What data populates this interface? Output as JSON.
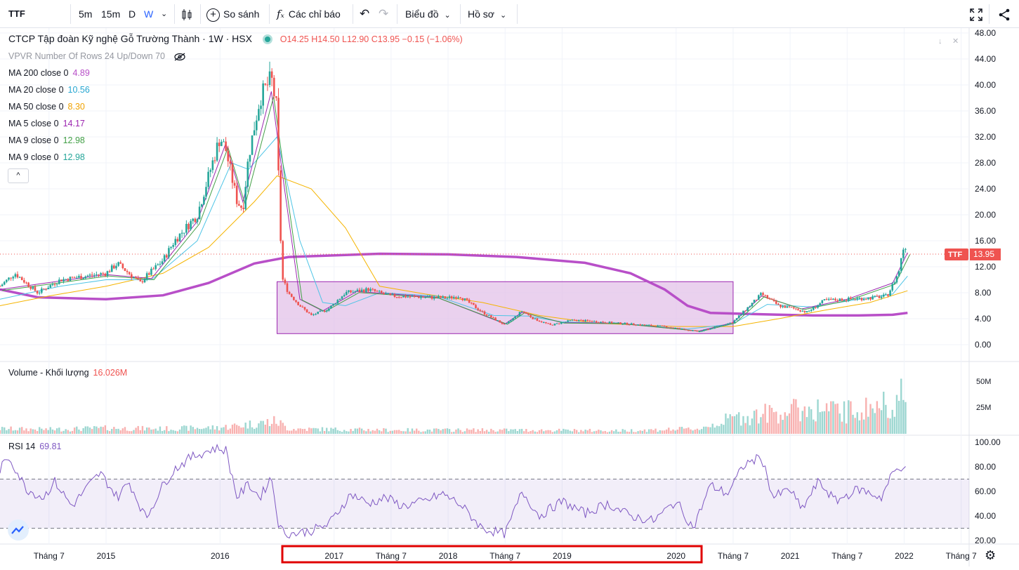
{
  "toolbar": {
    "symbol": "TTF",
    "intervals": [
      "5m",
      "15m",
      "D",
      "W"
    ],
    "active_interval": "W",
    "compare_label": "So sánh",
    "indicators_label": "Các chỉ báo",
    "chart_type_label": "Biểu đồ",
    "profile_label": "Hồ sơ"
  },
  "legend": {
    "title": "CTCP Tập đoàn Kỹ nghệ Gỗ Trường Thành · 1W · HSX",
    "ohlc": {
      "o": "O14.25",
      "h": "H14.50",
      "l": "L12.90",
      "c": "C13.95",
      "chg": "−0.15 (−1.06%)"
    },
    "vpvr": "VPVR Number Of Rows 24 Up/Down 70",
    "ma": [
      {
        "label": "MA 200 close 0",
        "value": "4.89",
        "color": "#b84fc8"
      },
      {
        "label": "MA 20 close 0",
        "value": "10.56",
        "color": "#26a6d1"
      },
      {
        "label": "MA 50 close 0",
        "value": "8.30",
        "color": "#f0a200"
      },
      {
        "label": "MA 5 close 0",
        "value": "14.17",
        "color": "#9c27b0"
      },
      {
        "label": "MA 9 close 0",
        "value": "12.98",
        "color": "#43a047"
      },
      {
        "label": "MA 9 close 0",
        "value": "12.98",
        "color": "#26a69a"
      }
    ],
    "collapse": "^"
  },
  "volume_legend": {
    "label": "Volume - Khối lượng",
    "value": "16.026M"
  },
  "rsi_legend": {
    "label": "RSI 14",
    "value": "69.81"
  },
  "price_label": {
    "symbol": "TTF",
    "value": "13.95"
  },
  "colors": {
    "up": "#26a69a",
    "down": "#ef5350",
    "ma200": "#b84fc8",
    "rsi": "#7e57c2",
    "box": "#e1bee7"
  },
  "chart_data": {
    "type": "candlestick",
    "price_axis": {
      "ticks": [
        "48.00",
        "44.00",
        "40.00",
        "36.00",
        "32.00",
        "28.00",
        "24.00",
        "20.00",
        "16.00",
        "12.00",
        "8.00",
        "4.00",
        "0.00"
      ],
      "ylim": [
        0,
        48
      ]
    },
    "volume_axis": {
      "ticks": [
        "50M",
        "25M"
      ]
    },
    "rsi_axis": {
      "ticks": [
        "100.00",
        "80.00",
        "60.00",
        "40.00",
        "20.00"
      ],
      "bands": [
        70,
        30
      ]
    },
    "time_axis": [
      "Tháng 7",
      "2015",
      "2016",
      "2017",
      "Tháng 7",
      "2018",
      "Tháng 7",
      "2019",
      "2020",
      "Tháng 7",
      "2021",
      "Tháng 7",
      "2022",
      "Tháng 7"
    ],
    "time_axis_x": [
      2014.5,
      2015.0,
      2016.0,
      2017.0,
      2017.5,
      2018.0,
      2018.5,
      2019.0,
      2020.0,
      2020.5,
      2021.0,
      2021.5,
      2022.0,
      2022.5
    ],
    "xlim": [
      2014.07,
      2022.57
    ],
    "price_close_points": [
      [
        2014.07,
        9.0
      ],
      [
        2014.2,
        11.0
      ],
      [
        2014.3,
        9.5
      ],
      [
        2014.4,
        8.0
      ],
      [
        2014.6,
        10.0
      ],
      [
        2014.8,
        10.5
      ],
      [
        2015.0,
        11.0
      ],
      [
        2015.1,
        12.5
      ],
      [
        2015.2,
        11.0
      ],
      [
        2015.3,
        9.5
      ],
      [
        2015.35,
        10.5
      ],
      [
        2015.5,
        13.0
      ],
      [
        2015.6,
        16.0
      ],
      [
        2015.7,
        18.0
      ],
      [
        2015.8,
        20.0
      ],
      [
        2015.9,
        26.0
      ],
      [
        2016.0,
        32.0
      ],
      [
        2016.05,
        30.0
      ],
      [
        2016.15,
        22.0
      ],
      [
        2016.2,
        21.0
      ],
      [
        2016.25,
        29.0
      ],
      [
        2016.35,
        38.0
      ],
      [
        2016.45,
        41.0
      ],
      [
        2016.5,
        36.0
      ],
      [
        2016.52,
        20.0
      ],
      [
        2016.55,
        10.0
      ],
      [
        2016.6,
        8.0
      ],
      [
        2016.7,
        6.0
      ],
      [
        2016.8,
        4.5
      ],
      [
        2016.95,
        5.5
      ],
      [
        2017.1,
        8.0
      ],
      [
        2017.3,
        8.5
      ],
      [
        2017.5,
        7.5
      ],
      [
        2018.0,
        7.2
      ],
      [
        2018.1,
        7.5
      ],
      [
        2018.3,
        5.0
      ],
      [
        2018.5,
        3.0
      ],
      [
        2018.65,
        5.2
      ],
      [
        2018.75,
        4.0
      ],
      [
        2018.9,
        3.0
      ],
      [
        2019.1,
        3.8
      ],
      [
        2019.5,
        3.3
      ],
      [
        2019.9,
        2.8
      ],
      [
        2020.2,
        2.0
      ],
      [
        2020.4,
        3.0
      ],
      [
        2020.5,
        3.5
      ],
      [
        2020.75,
        7.8
      ],
      [
        2020.9,
        6.0
      ],
      [
        2021.05,
        5.5
      ],
      [
        2021.15,
        5.0
      ],
      [
        2021.3,
        6.8
      ],
      [
        2021.5,
        7.0
      ],
      [
        2021.7,
        7.2
      ],
      [
        2021.85,
        7.5
      ],
      [
        2021.95,
        11.0
      ],
      [
        2022.0,
        15.5
      ],
      [
        2022.03,
        13.95
      ]
    ],
    "ma200_points": [
      [
        2014.07,
        8.5
      ],
      [
        2014.4,
        7.3
      ],
      [
        2015.0,
        7.0
      ],
      [
        2015.5,
        7.6
      ],
      [
        2015.9,
        9.5
      ],
      [
        2016.3,
        12.5
      ],
      [
        2016.6,
        13.5
      ],
      [
        2017.4,
        14.0
      ],
      [
        2018.0,
        13.9
      ],
      [
        2018.6,
        13.5
      ],
      [
        2019.2,
        12.6
      ],
      [
        2019.6,
        11.0
      ],
      [
        2019.9,
        8.5
      ],
      [
        2020.1,
        6.0
      ],
      [
        2020.3,
        4.9
      ],
      [
        2020.7,
        4.7
      ],
      [
        2021.2,
        4.5
      ],
      [
        2021.6,
        4.5
      ],
      [
        2021.9,
        4.6
      ],
      [
        2022.03,
        4.9
      ]
    ],
    "ma50_points": [
      [
        2014.07,
        6.0
      ],
      [
        2014.5,
        7.5
      ],
      [
        2015.0,
        9.0
      ],
      [
        2015.5,
        11.0
      ],
      [
        2015.9,
        15.0
      ],
      [
        2016.3,
        22.0
      ],
      [
        2016.5,
        26.0
      ],
      [
        2016.8,
        24.0
      ],
      [
        2017.1,
        18.0
      ],
      [
        2017.4,
        9.0
      ],
      [
        2017.8,
        7.8
      ],
      [
        2018.3,
        6.5
      ],
      [
        2018.8,
        4.5
      ],
      [
        2019.3,
        3.3
      ],
      [
        2020.0,
        2.8
      ],
      [
        2020.5,
        2.8
      ],
      [
        2020.9,
        4.0
      ],
      [
        2021.3,
        5.3
      ],
      [
        2021.7,
        6.5
      ],
      [
        2022.03,
        8.3
      ]
    ],
    "ma20_points": [
      [
        2014.07,
        7.0
      ],
      [
        2014.6,
        9.0
      ],
      [
        2015.0,
        10.0
      ],
      [
        2015.4,
        10.0
      ],
      [
        2015.8,
        16.0
      ],
      [
        2016.1,
        28.0
      ],
      [
        2016.25,
        27.0
      ],
      [
        2016.5,
        32.0
      ],
      [
        2016.7,
        16.0
      ],
      [
        2016.9,
        6.5
      ],
      [
        2017.1,
        6.0
      ],
      [
        2017.4,
        8.0
      ],
      [
        2017.9,
        7.5
      ],
      [
        2018.4,
        4.5
      ],
      [
        2018.7,
        4.4
      ],
      [
        2019.0,
        3.5
      ],
      [
        2019.5,
        3.3
      ],
      [
        2020.1,
        2.4
      ],
      [
        2020.5,
        3.2
      ],
      [
        2020.8,
        6.2
      ],
      [
        2021.2,
        5.8
      ],
      [
        2021.6,
        7.0
      ],
      [
        2021.9,
        7.8
      ],
      [
        2022.03,
        10.56
      ]
    ],
    "ma5_points": [
      [
        2014.07,
        8.5
      ],
      [
        2014.6,
        9.8
      ],
      [
        2015.0,
        10.8
      ],
      [
        2015.4,
        10.2
      ],
      [
        2015.8,
        19.0
      ],
      [
        2016.05,
        31.0
      ],
      [
        2016.2,
        22.0
      ],
      [
        2016.45,
        39.0
      ],
      [
        2016.55,
        26.0
      ],
      [
        2016.7,
        7.0
      ],
      [
        2016.9,
        5.2
      ],
      [
        2017.2,
        8.2
      ],
      [
        2017.9,
        7.3
      ],
      [
        2018.5,
        3.2
      ],
      [
        2018.65,
        5.0
      ],
      [
        2019.0,
        3.4
      ],
      [
        2019.5,
        3.3
      ],
      [
        2020.2,
        2.1
      ],
      [
        2020.5,
        3.4
      ],
      [
        2020.75,
        7.5
      ],
      [
        2021.1,
        5.5
      ],
      [
        2021.5,
        7.0
      ],
      [
        2021.9,
        9.5
      ],
      [
        2022.03,
        14.17
      ]
    ],
    "box": {
      "x0": 2016.5,
      "x1": 2020.5,
      "y0": 1.7,
      "y1": 9.7
    },
    "last_price": 13.95,
    "volume_points": [
      [
        2014.07,
        8
      ],
      [
        2014.5,
        7
      ],
      [
        2015.0,
        9
      ],
      [
        2015.5,
        8
      ],
      [
        2016.0,
        10
      ],
      [
        2016.5,
        20
      ],
      [
        2016.6,
        8
      ],
      [
        2017.5,
        6
      ],
      [
        2018.5,
        6
      ],
      [
        2019.5,
        5
      ],
      [
        2020.2,
        8
      ],
      [
        2020.5,
        25
      ],
      [
        2020.9,
        35
      ],
      [
        2021.2,
        40
      ],
      [
        2021.5,
        35
      ],
      [
        2021.8,
        45
      ],
      [
        2022.0,
        60
      ],
      [
        2022.03,
        16
      ]
    ],
    "rsi_points": [
      [
        2014.07,
        78
      ],
      [
        2014.15,
        88
      ],
      [
        2014.3,
        62
      ],
      [
        2014.45,
        55
      ],
      [
        2014.55,
        68
      ],
      [
        2014.7,
        48
      ],
      [
        2014.85,
        65
      ],
      [
        2014.95,
        75
      ],
      [
        2015.1,
        55
      ],
      [
        2015.2,
        68
      ],
      [
        2015.35,
        38
      ],
      [
        2015.5,
        65
      ],
      [
        2015.6,
        78
      ],
      [
        2015.75,
        88
      ],
      [
        2015.95,
        95
      ],
      [
        2016.05,
        94
      ],
      [
        2016.15,
        55
      ],
      [
        2016.25,
        66
      ],
      [
        2016.35,
        55
      ],
      [
        2016.45,
        72
      ],
      [
        2016.52,
        30
      ],
      [
        2016.6,
        25
      ],
      [
        2016.8,
        28
      ],
      [
        2016.95,
        33
      ],
      [
        2017.15,
        58
      ],
      [
        2017.3,
        50
      ],
      [
        2017.45,
        55
      ],
      [
        2017.6,
        48
      ],
      [
        2017.8,
        52
      ],
      [
        2017.95,
        58
      ],
      [
        2018.1,
        50
      ],
      [
        2018.3,
        30
      ],
      [
        2018.5,
        25
      ],
      [
        2018.65,
        60
      ],
      [
        2018.8,
        40
      ],
      [
        2019.0,
        52
      ],
      [
        2019.2,
        42
      ],
      [
        2019.4,
        50
      ],
      [
        2019.6,
        40
      ],
      [
        2019.8,
        36
      ],
      [
        2020.0,
        52
      ],
      [
        2020.15,
        30
      ],
      [
        2020.3,
        65
      ],
      [
        2020.45,
        58
      ],
      [
        2020.6,
        82
      ],
      [
        2020.75,
        88
      ],
      [
        2020.85,
        55
      ],
      [
        2021.0,
        62
      ],
      [
        2021.1,
        45
      ],
      [
        2021.25,
        68
      ],
      [
        2021.4,
        52
      ],
      [
        2021.6,
        62
      ],
      [
        2021.8,
        55
      ],
      [
        2021.9,
        75
      ],
      [
        2022.0,
        82
      ],
      [
        2022.03,
        69.81
      ]
    ]
  }
}
